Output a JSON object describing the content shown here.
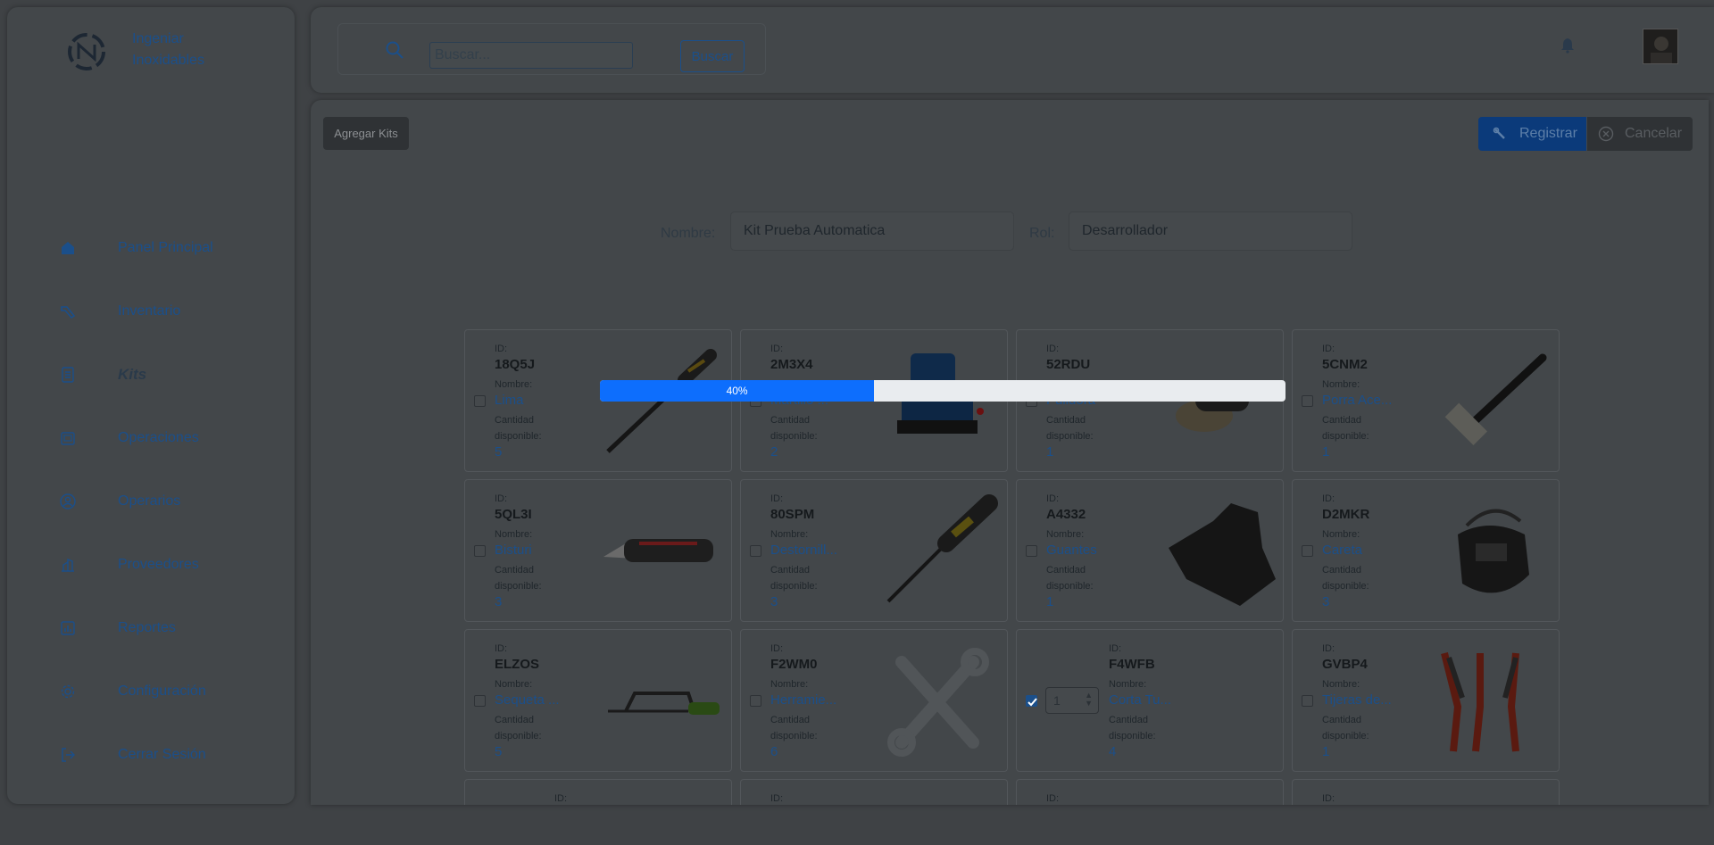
{
  "brand": {
    "line1": "Ingeniar",
    "line2": "Inoxidables"
  },
  "sidebar": {
    "items": [
      {
        "label": "Panel Principal",
        "icon": "home-icon"
      },
      {
        "label": "Inventario",
        "icon": "tools-icon"
      },
      {
        "label": "Kits",
        "icon": "list-icon",
        "active": true
      },
      {
        "label": "Operaciones",
        "icon": "folder-icon"
      },
      {
        "label": "Operarios",
        "icon": "user-circle-icon"
      },
      {
        "label": "Proveedores",
        "icon": "building-icon"
      },
      {
        "label": "Reportes",
        "icon": "chart-icon"
      },
      {
        "label": "Configuración",
        "icon": "gear-icon"
      },
      {
        "label": "Cerrar Sesión",
        "icon": "logout-icon"
      }
    ]
  },
  "search": {
    "placeholder": "Buscar...",
    "button": "Buscar"
  },
  "toolbar": {
    "add_kits": "Agregar Kits",
    "register": "Registrar",
    "cancel": "Cancelar"
  },
  "form": {
    "name_label": "Nombre:",
    "name_value": "Kit Prueba Automatica",
    "role_label": "Rol:",
    "role_value": "Desarrollador"
  },
  "progress": {
    "value": 40,
    "label": "40%"
  },
  "card_labels": {
    "id": "ID:",
    "name": "Nombre:",
    "qty1": "Cantidad",
    "qty2": "disponible:"
  },
  "tools": [
    {
      "id": "18Q5J",
      "name": "Lima",
      "qty": "5"
    },
    {
      "id": "2M3X4",
      "name": "Martillo ...",
      "qty": "2"
    },
    {
      "id": "52RDU",
      "name": "Pulidora",
      "qty": "1"
    },
    {
      "id": "5CNM2",
      "name": "Porra Ace...",
      "qty": "1"
    },
    {
      "id": "5QL3I",
      "name": "Bisturi",
      "qty": "3"
    },
    {
      "id": "80SPM",
      "name": "Destornill...",
      "qty": "3"
    },
    {
      "id": "A4332",
      "name": "Guantes",
      "qty": "1"
    },
    {
      "id": "D2MKR",
      "name": "Careta",
      "qty": "3"
    },
    {
      "id": "ELZOS",
      "name": "Sequeta ...",
      "qty": "5"
    },
    {
      "id": "F2WM0",
      "name": "Herramie...",
      "qty": "6"
    },
    {
      "id": "F4WFB",
      "name": "Corta Tu...",
      "qty": "4",
      "selected": true,
      "stepper": "1"
    },
    {
      "id": "GVBP4",
      "name": "Tijeras de...",
      "qty": "1"
    }
  ],
  "colors": {
    "accent": "#0d6efd",
    "brand_blue": "#1b4f8a"
  }
}
